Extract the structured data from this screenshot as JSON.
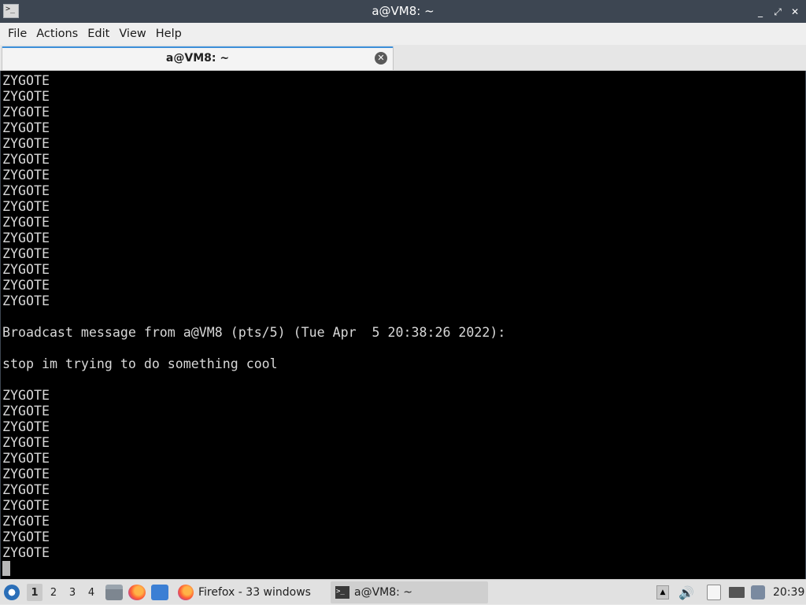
{
  "window": {
    "title": "a@VM8: ~",
    "controls": {
      "minimize": "_",
      "maximize": "⤢",
      "close": "✕"
    }
  },
  "menu": [
    "File",
    "Actions",
    "Edit",
    "View",
    "Help"
  ],
  "tab": {
    "label": "a@VM8: ~"
  },
  "terminal": {
    "lines": [
      "ZYGOTE",
      "ZYGOTE",
      "ZYGOTE",
      "ZYGOTE",
      "ZYGOTE",
      "ZYGOTE",
      "ZYGOTE",
      "ZYGOTE",
      "ZYGOTE",
      "ZYGOTE",
      "ZYGOTE",
      "ZYGOTE",
      "ZYGOTE",
      "ZYGOTE",
      "ZYGOTE",
      "",
      "Broadcast message from a@VM8 (pts/5) (Tue Apr  5 20:38:26 2022):",
      "",
      "stop im trying to do something cool",
      "",
      "ZYGOTE",
      "ZYGOTE",
      "ZYGOTE",
      "ZYGOTE",
      "ZYGOTE",
      "ZYGOTE",
      "ZYGOTE",
      "ZYGOTE",
      "ZYGOTE",
      "ZYGOTE",
      "ZYGOTE"
    ]
  },
  "taskbar": {
    "desktops": [
      "1",
      "2",
      "3",
      "4"
    ],
    "active_desktop": "1",
    "tasks": [
      {
        "label": "Firefox - 33 windows",
        "icon": "firefox-icon"
      },
      {
        "label": "a@VM8: ~",
        "icon": "terminal-icon"
      }
    ],
    "clock": "20:39"
  },
  "colors": {
    "titlebar": "#3d4652",
    "terminal_bg": "#000000",
    "terminal_fg": "#d8d8d8",
    "tab_accent": "#3b8ed8"
  }
}
